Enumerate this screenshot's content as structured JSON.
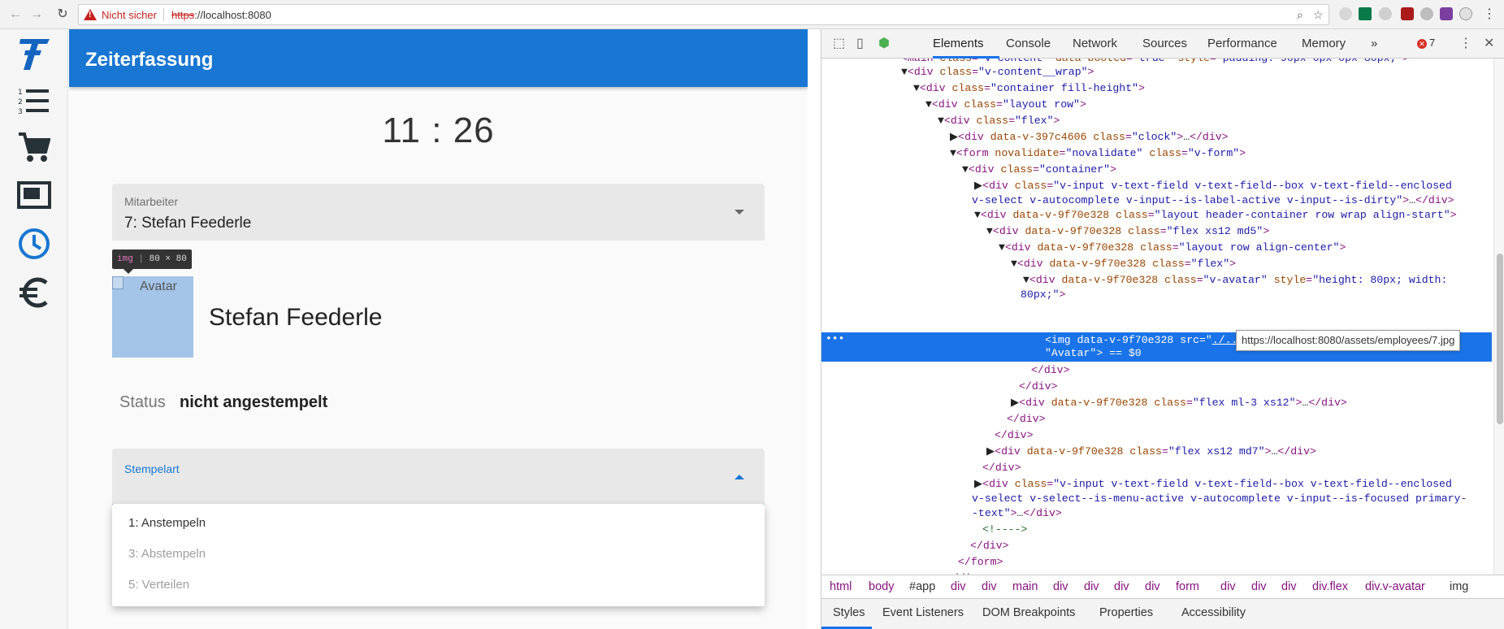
{
  "browser": {
    "insecure_label": "Nicht sicher",
    "url_scheme": "https",
    "url_rest": "://localhost:8080"
  },
  "app": {
    "title": "Zeiterfassung",
    "clock_text": "11 : 26",
    "employee_field": {
      "label": "Mitarbeiter",
      "value": "7: Stefan Feederle"
    },
    "img_tooltip": {
      "tag": "img",
      "size": "80 × 80"
    },
    "avatar_alt": "Avatar",
    "employee_name": "Stefan Feederle",
    "status": {
      "label": "Status",
      "value": "nicht angestempelt"
    },
    "stamp_field": {
      "label": "Stempelart"
    },
    "stamp_options": [
      "1: Anstempeln",
      "3: Abstempeln",
      "5: Verteilen"
    ]
  },
  "rail_icons": [
    "logo-icon",
    "list-icon",
    "cart-icon",
    "monitor-icon",
    "clock-icon",
    "euro-icon"
  ],
  "devtools": {
    "tabs": [
      "Elements",
      "Console",
      "Network",
      "Sources",
      "Performance",
      "Memory"
    ],
    "more_label": "»",
    "error_count": "7",
    "url_tooltip": "https://localhost:8080/assets/employees/7.jpg",
    "breadcrumbs": [
      "html",
      "body",
      "#app",
      "div",
      "div",
      "main",
      "div",
      "div",
      "div",
      "div",
      "form",
      "div",
      "div",
      "div",
      "div.flex",
      "div.v-avatar",
      "img"
    ],
    "subtabs": [
      "Styles",
      "Event Listeners",
      "DOM Breakpoints",
      "Properties",
      "Accessibility"
    ]
  },
  "colors": {
    "primary": "#1976d2",
    "selection": "#1a73e8",
    "error": "#d93025"
  }
}
